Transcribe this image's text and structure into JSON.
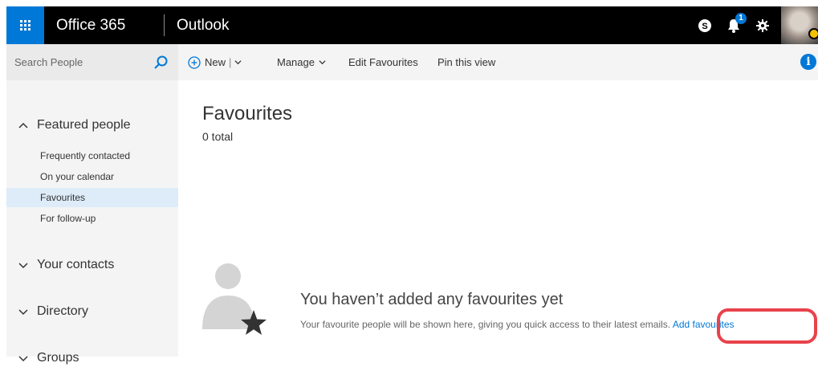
{
  "topbar": {
    "brand": "Office 365",
    "app": "Outlook",
    "notification_count": "1",
    "icons": [
      "app-launcher-icon",
      "skype-icon",
      "bell-icon",
      "gear-icon",
      "help-icon"
    ],
    "help_label": "?"
  },
  "search": {
    "placeholder": "Search People"
  },
  "sidebar": {
    "featured": {
      "label": "Featured people",
      "items": [
        {
          "label": "Frequently contacted"
        },
        {
          "label": "On your calendar"
        },
        {
          "label": "Favourites",
          "selected": true
        },
        {
          "label": "For follow-up"
        }
      ]
    },
    "contacts_label": "Your contacts",
    "directory_label": "Directory",
    "groups_label": "Groups"
  },
  "toolbar": {
    "new_label": "New",
    "manage_label": "Manage",
    "edit_label": "Edit Favourites",
    "pin_label": "Pin this view",
    "info_label": "i"
  },
  "main": {
    "title": "Favourites",
    "count": "0 total",
    "empty_title": "You haven’t added any favourites yet",
    "empty_desc": "Your favourite people will be shown here, giving you quick access to their latest emails.",
    "add_link": "Add favourites"
  },
  "colors": {
    "accent": "#0078d7",
    "topbar_bg": "#000000",
    "selected_bg": "#deecf9",
    "pane_bg": "#f4f4f4",
    "highlight": "#e8424b"
  }
}
